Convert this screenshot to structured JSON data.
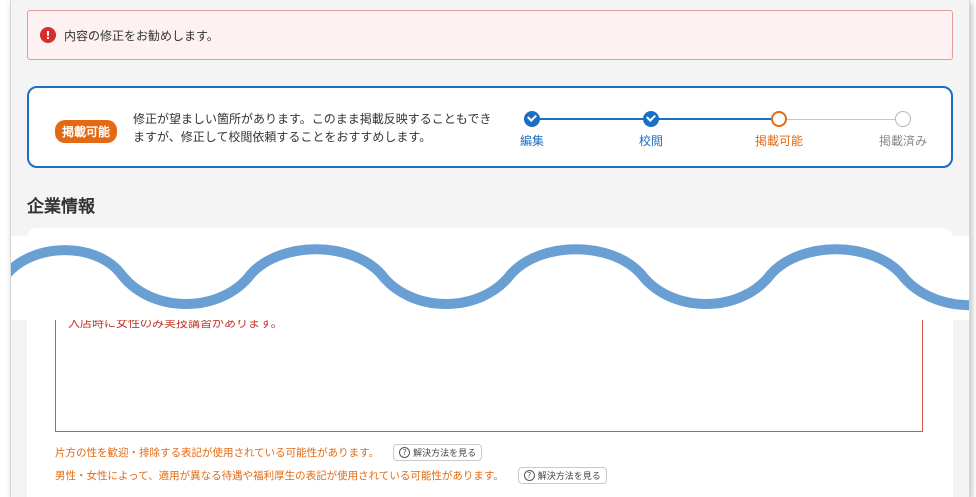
{
  "alert": {
    "message": "内容の修正をお勧めします。",
    "icon": "exclamation-icon"
  },
  "status": {
    "badge": "掲載可能",
    "description": "修正が望ましい箇所があります。このまま掲載反映することもできますが、修正して校閲依頼することをおすすめします。",
    "steps": [
      {
        "label": "編集",
        "state": "done"
      },
      {
        "label": "校閲",
        "state": "done"
      },
      {
        "label": "掲載可能",
        "state": "current"
      },
      {
        "label": "掲載済み",
        "state": "todo"
      }
    ]
  },
  "section": {
    "title": "企業情報"
  },
  "form": {
    "textarea_value": "入店時に女性のみ実技講習があります。",
    "warnings": [
      {
        "text": "片方の性を歓迎・排除する表記が使用されている可能性があります。",
        "button": "解決方法を見る"
      },
      {
        "text": "男性・女性によって、適用が異なる待遇や福利厚生の表記が使用されている可能性があります。",
        "button": "解決方法を見る"
      }
    ]
  },
  "colors": {
    "primary": "#1b6ec2",
    "accent": "#e36a12",
    "error": "#d62d2d",
    "todo": "#b5b5b5"
  }
}
